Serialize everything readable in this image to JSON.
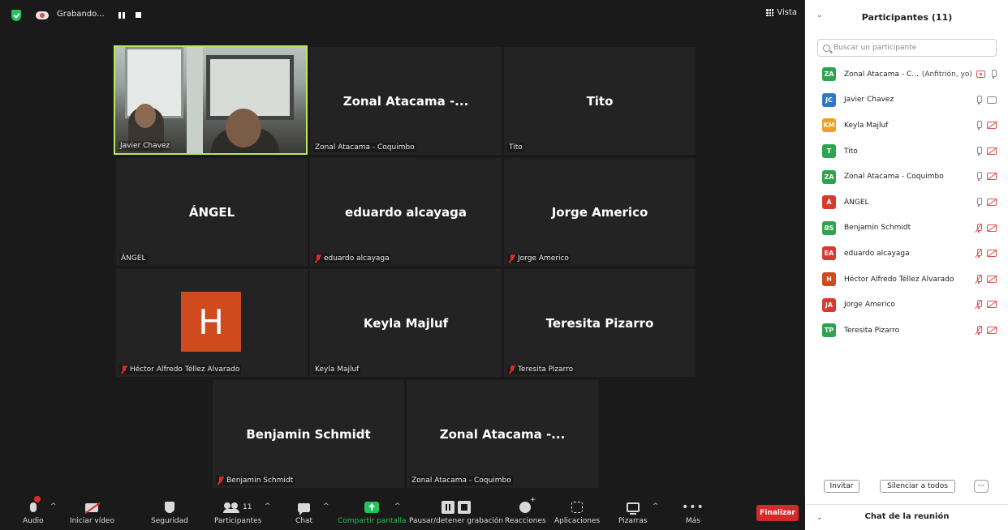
{
  "topbar": {
    "recording_label": "Grabando...",
    "view_label": "Vista"
  },
  "tiles": [
    {
      "big": "",
      "label": "Javier Chavez",
      "muted": false
    },
    {
      "big": "Zonal Atacama -...",
      "label": "Zonal Atacama - Coquimbo",
      "muted": false
    },
    {
      "big": "Tito",
      "label": "Tito",
      "muted": false
    },
    {
      "big": "ÁNGEL",
      "label": "ÁNGEL",
      "muted": false
    },
    {
      "big": "eduardo alcayaga",
      "label": "eduardo alcayaga",
      "muted": true
    },
    {
      "big": "Jorge Americo",
      "label": "Jorge Americo",
      "muted": true
    },
    {
      "big": "",
      "avatar_letter": "H",
      "label": "Héctor Alfredo Téllez Alvarado",
      "muted": true
    },
    {
      "big": "Keyla Majluf",
      "label": "Keyla Majluf",
      "muted": false
    },
    {
      "big": "Teresita Pizarro",
      "label": "Teresita Pizarro",
      "muted": true
    },
    {
      "big": "Benjamin Schmidt",
      "label": "Benjamin Schmidt",
      "muted": true
    },
    {
      "big": "Zonal Atacama -...",
      "label": "Zonal Atacama - Coquimbo",
      "muted": false
    }
  ],
  "toolbar": {
    "audio": "Audio",
    "video": "Iniciar vídeo",
    "security": "Seguridad",
    "participants": "Participantes",
    "participants_count": "11",
    "chat": "Chat",
    "share": "Compartir pantalla",
    "pause_recording": "Pausar/detener grabación",
    "reactions": "Reacciones",
    "apps": "Aplicaciones",
    "whiteboards": "Pizarras",
    "more": "Más",
    "end": "Finalizar"
  },
  "panel": {
    "title": "Participantes (11)",
    "search_placeholder": "Buscar un participante",
    "participants": [
      {
        "initials": "ZA",
        "color": "#2da44e",
        "name": "Zonal Atacama - C...",
        "suffix": "(Anfitrión, yo)",
        "mic": "on",
        "video": "share"
      },
      {
        "initials": "JC",
        "color": "#2e77c9",
        "name": "Javier Chavez",
        "suffix": "",
        "mic": "on",
        "video": "on"
      },
      {
        "initials": "KM",
        "color": "#f0a020",
        "name": "Keyla Majluf",
        "suffix": "",
        "mic": "on",
        "video": "off"
      },
      {
        "initials": "T",
        "color": "#2da44e",
        "name": "Tito",
        "suffix": "",
        "mic": "on",
        "video": "off"
      },
      {
        "initials": "ZA",
        "color": "#2da44e",
        "name": "Zonal Atacama - Coquimbo",
        "suffix": "",
        "mic": "on",
        "video": "off"
      },
      {
        "initials": "Á",
        "color": "#d9382f",
        "name": "ÁNGEL",
        "suffix": "",
        "mic": "on",
        "video": "off"
      },
      {
        "initials": "BS",
        "color": "#2da44e",
        "name": "Benjamin Schmidt",
        "suffix": "",
        "mic": "off",
        "video": "off"
      },
      {
        "initials": "EA",
        "color": "#d9382f",
        "name": "eduardo alcayaga",
        "suffix": "",
        "mic": "off",
        "video": "off"
      },
      {
        "initials": "H",
        "color": "#cf4a1c",
        "name": "Héctor Alfredo Téllez Alvarado",
        "suffix": "",
        "mic": "off",
        "video": "off"
      },
      {
        "initials": "JA",
        "color": "#d9382f",
        "name": "Jorge Americo",
        "suffix": "",
        "mic": "off",
        "video": "off"
      },
      {
        "initials": "TP",
        "color": "#2da44e",
        "name": "Teresita Pizarro",
        "suffix": "",
        "mic": "off",
        "video": "off"
      }
    ],
    "invite_label": "Invitar",
    "mute_all_label": "Silenciar a todos",
    "more_label": "···",
    "chat_title": "Chat de la reunión"
  }
}
